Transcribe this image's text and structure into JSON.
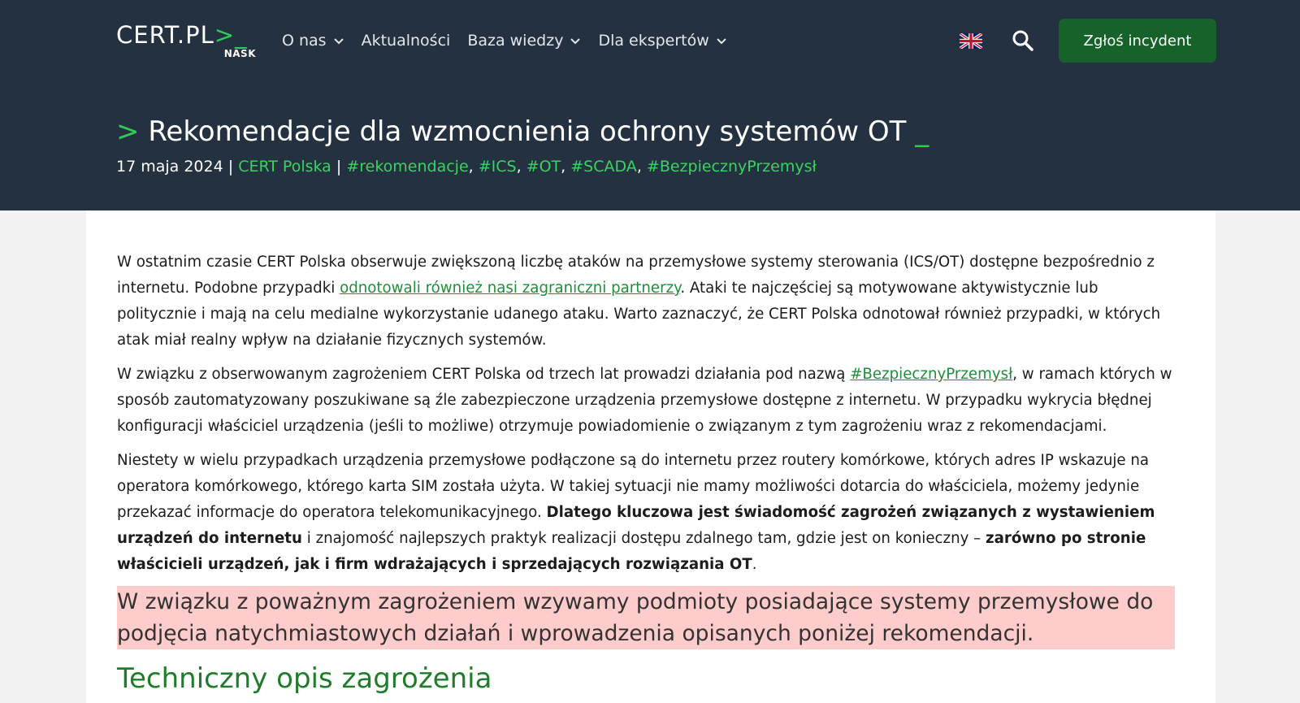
{
  "header": {
    "logo_text": "CERT.PL",
    "logo_prompt": ">_",
    "logo_subtext": "NASK",
    "nav": [
      {
        "label": "O nas",
        "has_dropdown": true
      },
      {
        "label": "Aktualności",
        "has_dropdown": false
      },
      {
        "label": "Baza wiedzy",
        "has_dropdown": true
      },
      {
        "label": "Dla ekspertów",
        "has_dropdown": true
      }
    ],
    "language_flag_icon": "uk-flag-icon",
    "search_icon": "search-icon",
    "report_button": "Zgłoś incydent",
    "colors": {
      "background": "#233140",
      "accent": "#2ecc55",
      "button": "#17612a"
    }
  },
  "article": {
    "title_prefix": ">",
    "title": "Rekomendacje dla wzmocnienia ochrony systemów OT",
    "title_suffix": "_",
    "date": "17 maja 2024",
    "separator": "|",
    "author": "CERT Polska",
    "tags": [
      "#rekomendacje",
      "#ICS",
      "#OT",
      "#SCADA",
      "#BezpiecznyPrzemysł"
    ],
    "p1_a": "W ostatnim czasie CERT Polska obserwuje zwiększoną liczbę ataków na przemysłowe systemy sterowania (ICS/OT) dostępne bezpośrednio z internetu. Podobne przypadki ",
    "p1_link": "odnotowali również nasi zagraniczni partnerzy",
    "p1_b": ". Ataki te najczęściej są motywowane aktywistycznie lub politycznie i mają na celu medialne wykorzystanie udanego ataku. Warto zaznaczyć, że CERT Polska odnotował również przypadki, w których atak miał realny wpływ na działanie fizycznych systemów.",
    "p2_a": "W związku z obserwowanym zagrożeniem CERT Polska od trzech lat prowadzi działania pod nazwą ",
    "p2_link": "#BezpiecznyPrzemysł",
    "p2_b": ", w ramach których w sposób zautomatyzowany poszukiwane są źle zabezpieczone urządzenia przemysłowe dostępne z internetu. W przypadku wykrycia błędnej konfiguracji właściciel urządzenia (jeśli to możliwe) otrzymuje powiadomienie o związanym z tym zagrożeniu wraz z rekomendacjami.",
    "p3_a": "Niestety w wielu przypadkach urządzenia przemysłowe podłączone są do internetu przez routery komórkowe, których adres IP wskazuje na operatora komórkowego, którego karta SIM została użyta. W takiej sytuacji nie mamy możliwości dotarcia do właściciela, możemy jedynie przekazać informacje do operatora telekomunikacyjnego. ",
    "p3_bold1": "Dlatego kluczowa jest świadomość zagrożeń związanych z wystawieniem urządzeń do internetu",
    "p3_b": " i znajomość najlepszych praktyk realizacji dostępu zdalnego tam, gdzie jest on konieczny – ",
    "p3_bold2": "zarówno po stronie właścicieli urządzeń, jak i firm wdrażających i sprzedających rozwiązania OT",
    "p3_c": ".",
    "alert": "W związku z poważnym zagrożeniem wzywamy podmioty posiadające systemy przemysłowe do podjęcia natychmiastowych działań i wprowadzenia opisanych poniżej rekomendacji.",
    "alert_color": "#ffcccc",
    "section_heading": "Techniczny opis zagrożenia",
    "heading_color": "#1e7d2a",
    "link_color": "#1f8f3a"
  }
}
